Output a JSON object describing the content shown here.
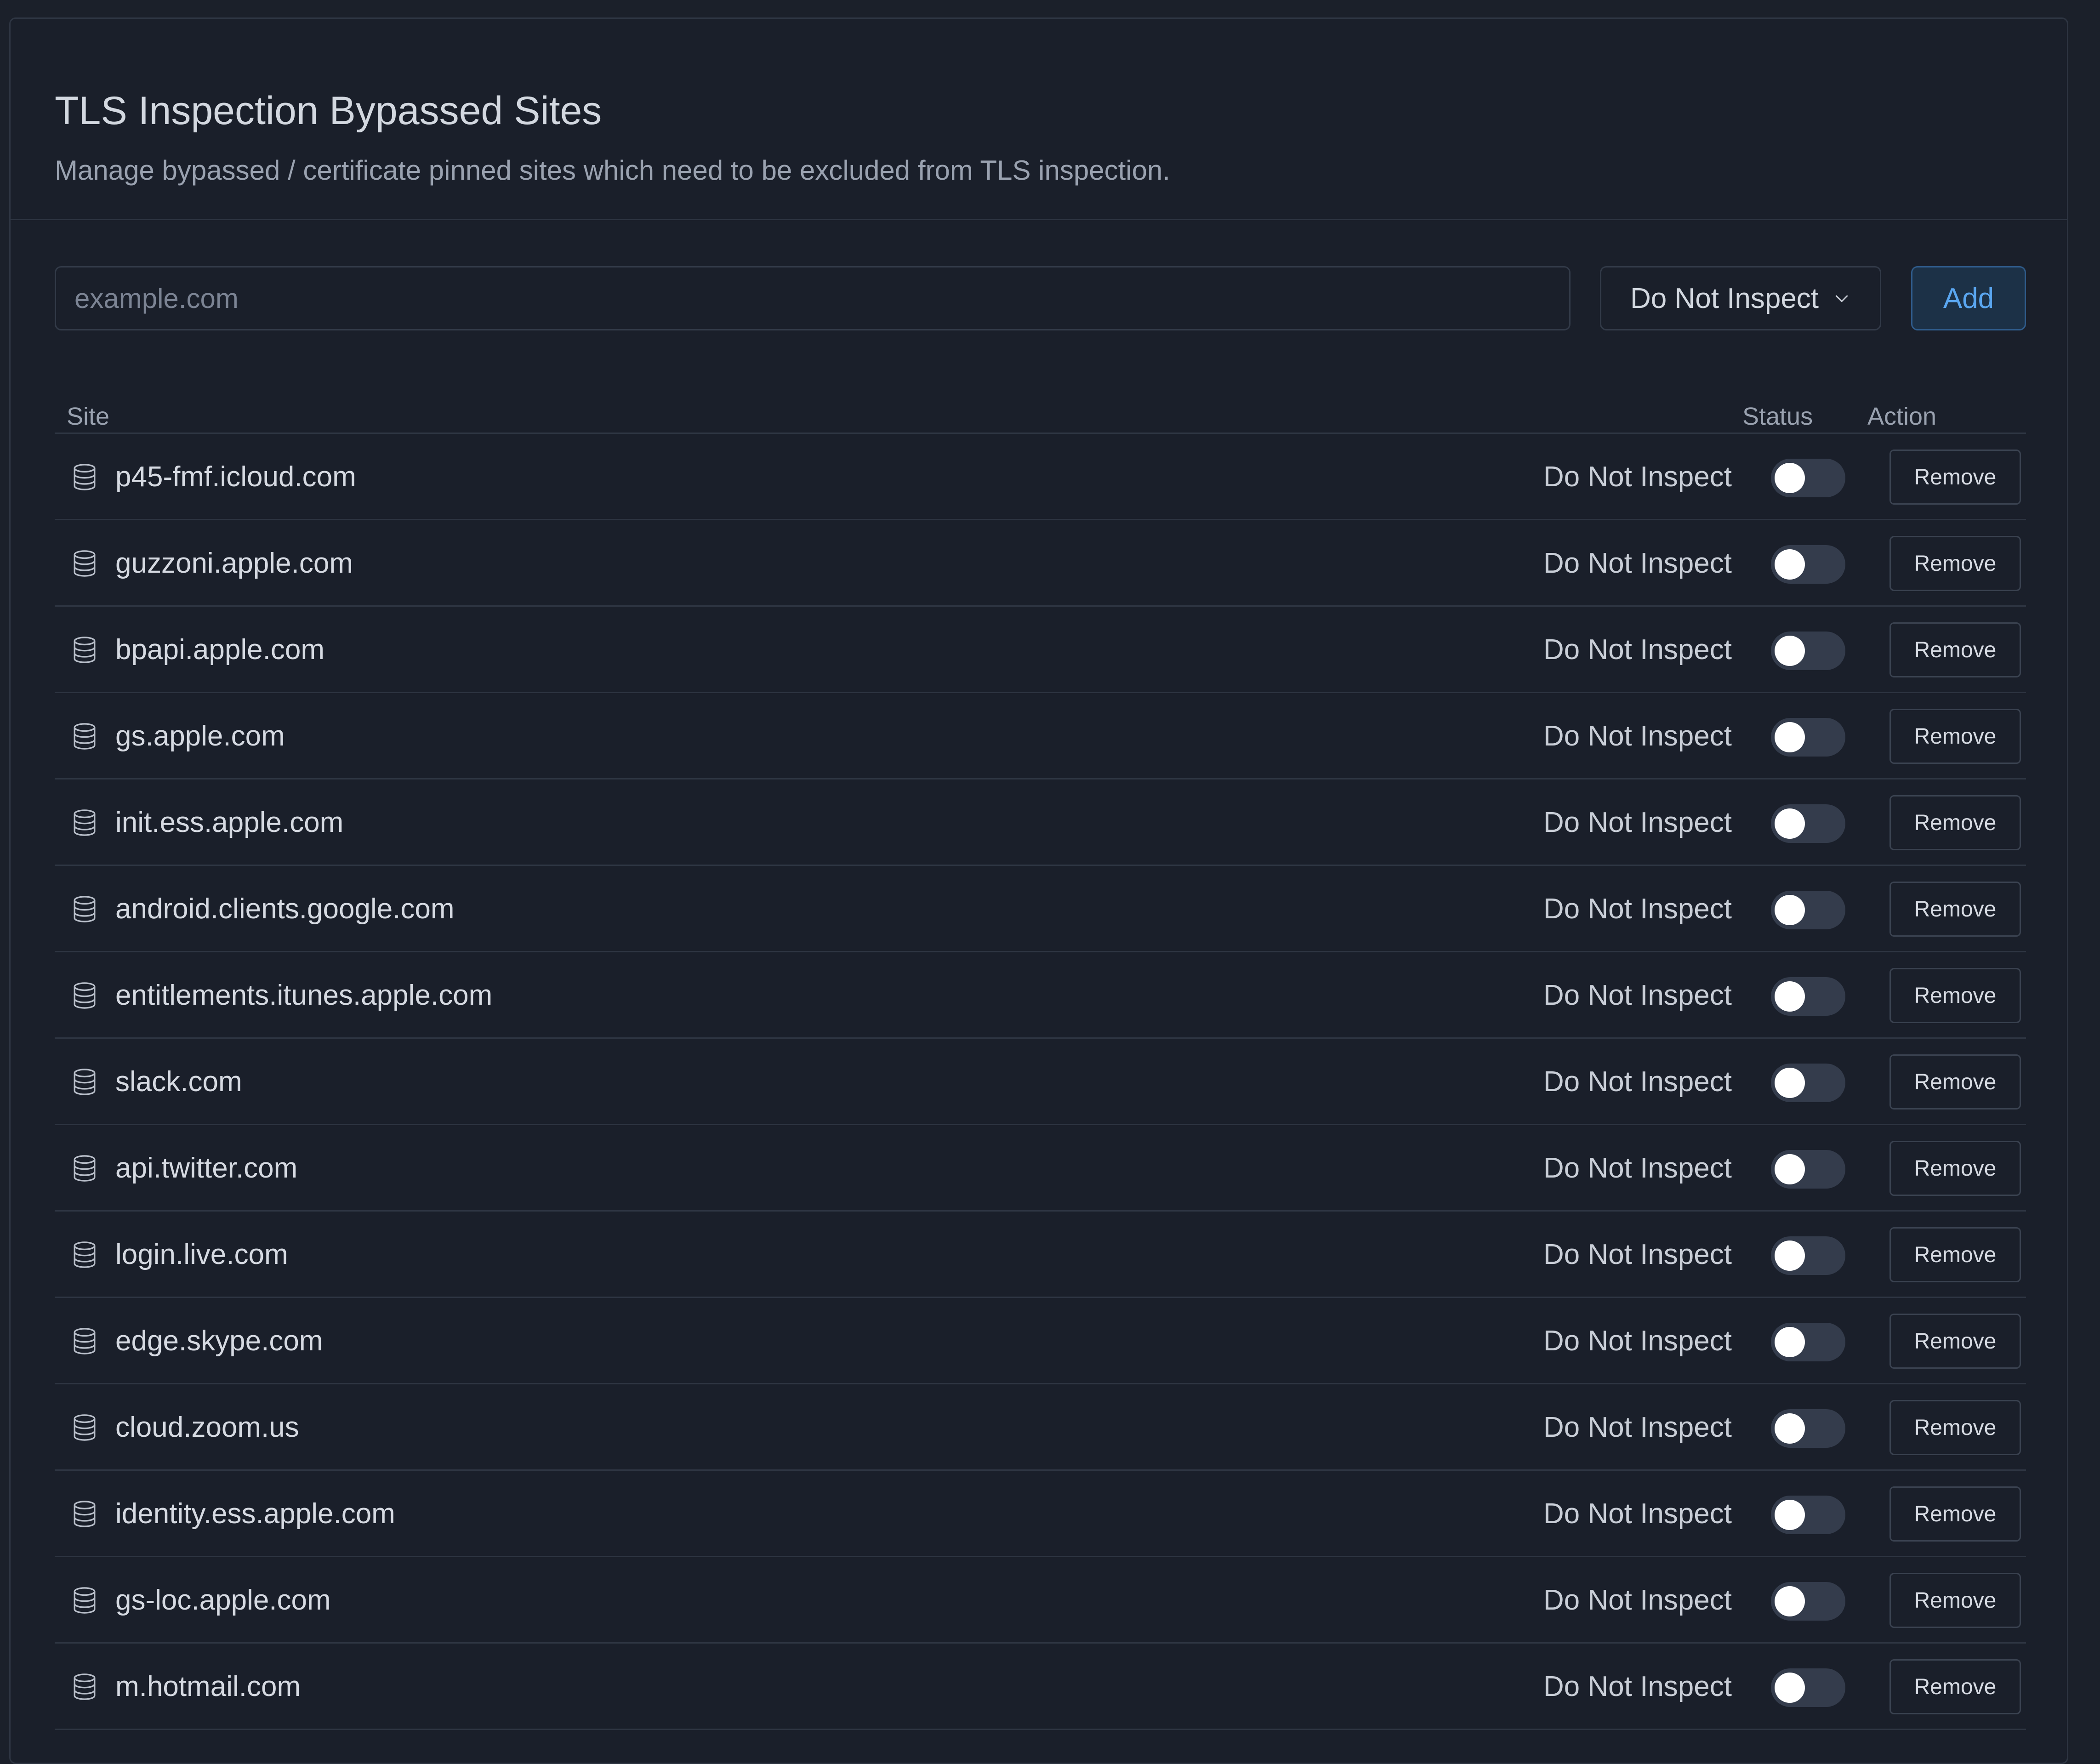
{
  "header": {
    "title": "TLS Inspection Bypassed Sites",
    "subtitle": "Manage bypassed / certificate pinned sites which need to be excluded from TLS inspection."
  },
  "form": {
    "site_placeholder": "example.com",
    "mode_selected": "Do Not Inspect",
    "add_label": "Add"
  },
  "table": {
    "columns": {
      "site": "Site",
      "status": "Status",
      "action": "Action"
    },
    "remove_label": "Remove",
    "rows": [
      {
        "site": "p45-fmf.icloud.com",
        "mode": "Do Not Inspect",
        "enabled": false
      },
      {
        "site": "guzzoni.apple.com",
        "mode": "Do Not Inspect",
        "enabled": false
      },
      {
        "site": "bpapi.apple.com",
        "mode": "Do Not Inspect",
        "enabled": false
      },
      {
        "site": "gs.apple.com",
        "mode": "Do Not Inspect",
        "enabled": false
      },
      {
        "site": "init.ess.apple.com",
        "mode": "Do Not Inspect",
        "enabled": false
      },
      {
        "site": "android.clients.google.com",
        "mode": "Do Not Inspect",
        "enabled": false
      },
      {
        "site": "entitlements.itunes.apple.com",
        "mode": "Do Not Inspect",
        "enabled": false
      },
      {
        "site": "slack.com",
        "mode": "Do Not Inspect",
        "enabled": false
      },
      {
        "site": "api.twitter.com",
        "mode": "Do Not Inspect",
        "enabled": false
      },
      {
        "site": "login.live.com",
        "mode": "Do Not Inspect",
        "enabled": false
      },
      {
        "site": "edge.skype.com",
        "mode": "Do Not Inspect",
        "enabled": false
      },
      {
        "site": "cloud.zoom.us",
        "mode": "Do Not Inspect",
        "enabled": false
      },
      {
        "site": "identity.ess.apple.com",
        "mode": "Do Not Inspect",
        "enabled": false
      },
      {
        "site": "gs-loc.apple.com",
        "mode": "Do Not Inspect",
        "enabled": false
      },
      {
        "site": "m.hotmail.com",
        "mode": "Do Not Inspect",
        "enabled": false
      }
    ]
  },
  "icons": {
    "row_icon": "database-icon",
    "select_icon": "chevron-down-icon"
  },
  "colors": {
    "background": "#1b202a",
    "accent": "#5aa6f0",
    "toggle_off": "#343c4c"
  }
}
